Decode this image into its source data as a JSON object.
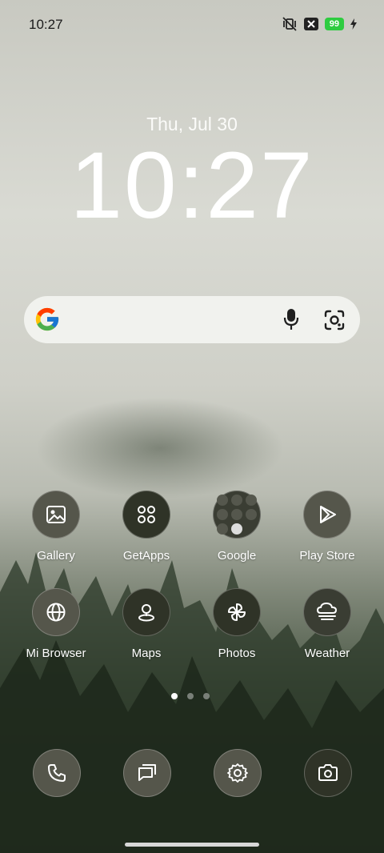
{
  "status_bar": {
    "time": "10:27",
    "battery": "99"
  },
  "lockscreen": {
    "date": "Thu, Jul 30",
    "time": "10:27"
  },
  "apps_row1": [
    {
      "label": "Gallery",
      "icon": "gallery-icon"
    },
    {
      "label": "GetApps",
      "icon": "getapps-icon"
    },
    {
      "label": "Google",
      "icon": "google-folder-icon"
    },
    {
      "label": "Play Store",
      "icon": "play-store-icon"
    }
  ],
  "apps_row2": [
    {
      "label": "Mi Browser",
      "icon": "globe-icon"
    },
    {
      "label": "Maps",
      "icon": "maps-icon"
    },
    {
      "label": "Photos",
      "icon": "pinwheel-icon"
    },
    {
      "label": "Weather",
      "icon": "weather-icon"
    }
  ],
  "dock": [
    {
      "icon": "phone-icon"
    },
    {
      "icon": "messages-icon"
    },
    {
      "icon": "settings-icon"
    },
    {
      "icon": "camera-icon"
    }
  ],
  "colors": {
    "battery": "#2ecc40",
    "search_bar": "#f1f2ee"
  }
}
